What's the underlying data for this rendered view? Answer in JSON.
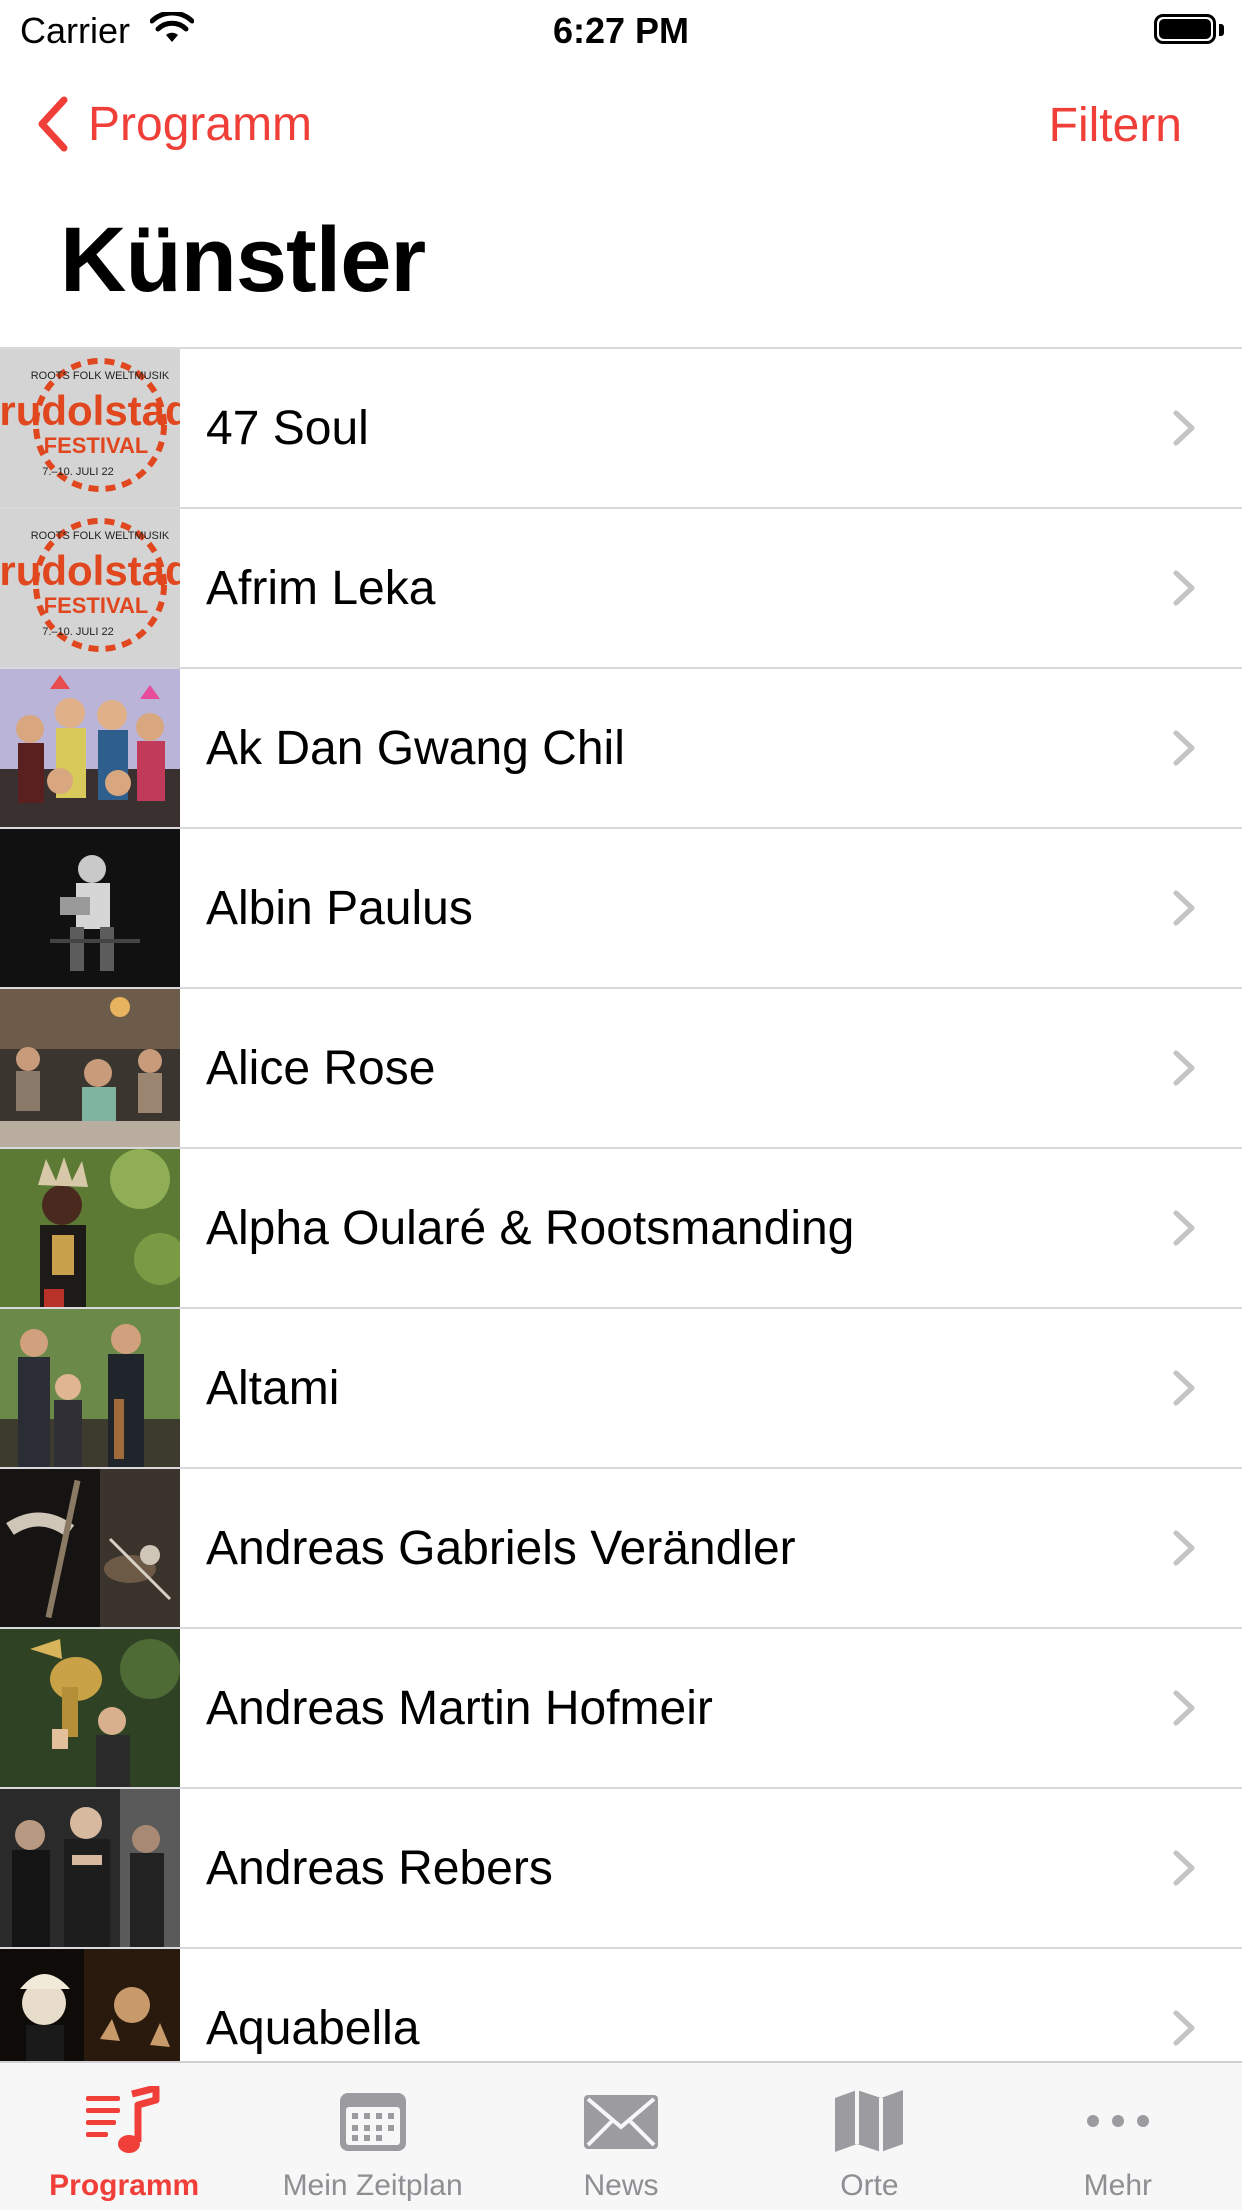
{
  "status_bar": {
    "carrier": "Carrier",
    "time": "6:27 PM"
  },
  "nav": {
    "back_label": "Programm",
    "filter_label": "Filtern"
  },
  "title": "Künstler",
  "thumb_logo": {
    "line1": "ROOTS FOLK WELTMUSIK",
    "line2": "rudolstadt",
    "line3": "FESTIVAL",
    "line4": "7.–10. JULI 22"
  },
  "artists": [
    {
      "name": "47 Soul",
      "thumb": "festival-logo"
    },
    {
      "name": "Afrim Leka",
      "thumb": "festival-logo"
    },
    {
      "name": "Ak Dan Gwang Chil",
      "thumb": "photo"
    },
    {
      "name": "Albin Paulus",
      "thumb": "photo"
    },
    {
      "name": "Alice Rose",
      "thumb": "photo"
    },
    {
      "name": "Alpha Oularé & Rootsmanding",
      "thumb": "photo"
    },
    {
      "name": "Altami",
      "thumb": "photo"
    },
    {
      "name": "Andreas Gabriels Verändler",
      "thumb": "photo"
    },
    {
      "name": "Andreas Martin Hofmeir",
      "thumb": "photo"
    },
    {
      "name": "Andreas Rebers",
      "thumb": "photo"
    },
    {
      "name": "Aquabella",
      "thumb": "photo"
    }
  ],
  "tabs": [
    {
      "label": "Programm",
      "icon": "music-list-icon",
      "active": true
    },
    {
      "label": "Mein Zeitplan",
      "icon": "calendar-icon",
      "active": false
    },
    {
      "label": "News",
      "icon": "envelope-icon",
      "active": false
    },
    {
      "label": "Orte",
      "icon": "map-icon",
      "active": false
    },
    {
      "label": "Mehr",
      "icon": "more-icon",
      "active": false
    }
  ],
  "colors": {
    "accent": "#f03f38",
    "inactive": "#8e8e93"
  }
}
